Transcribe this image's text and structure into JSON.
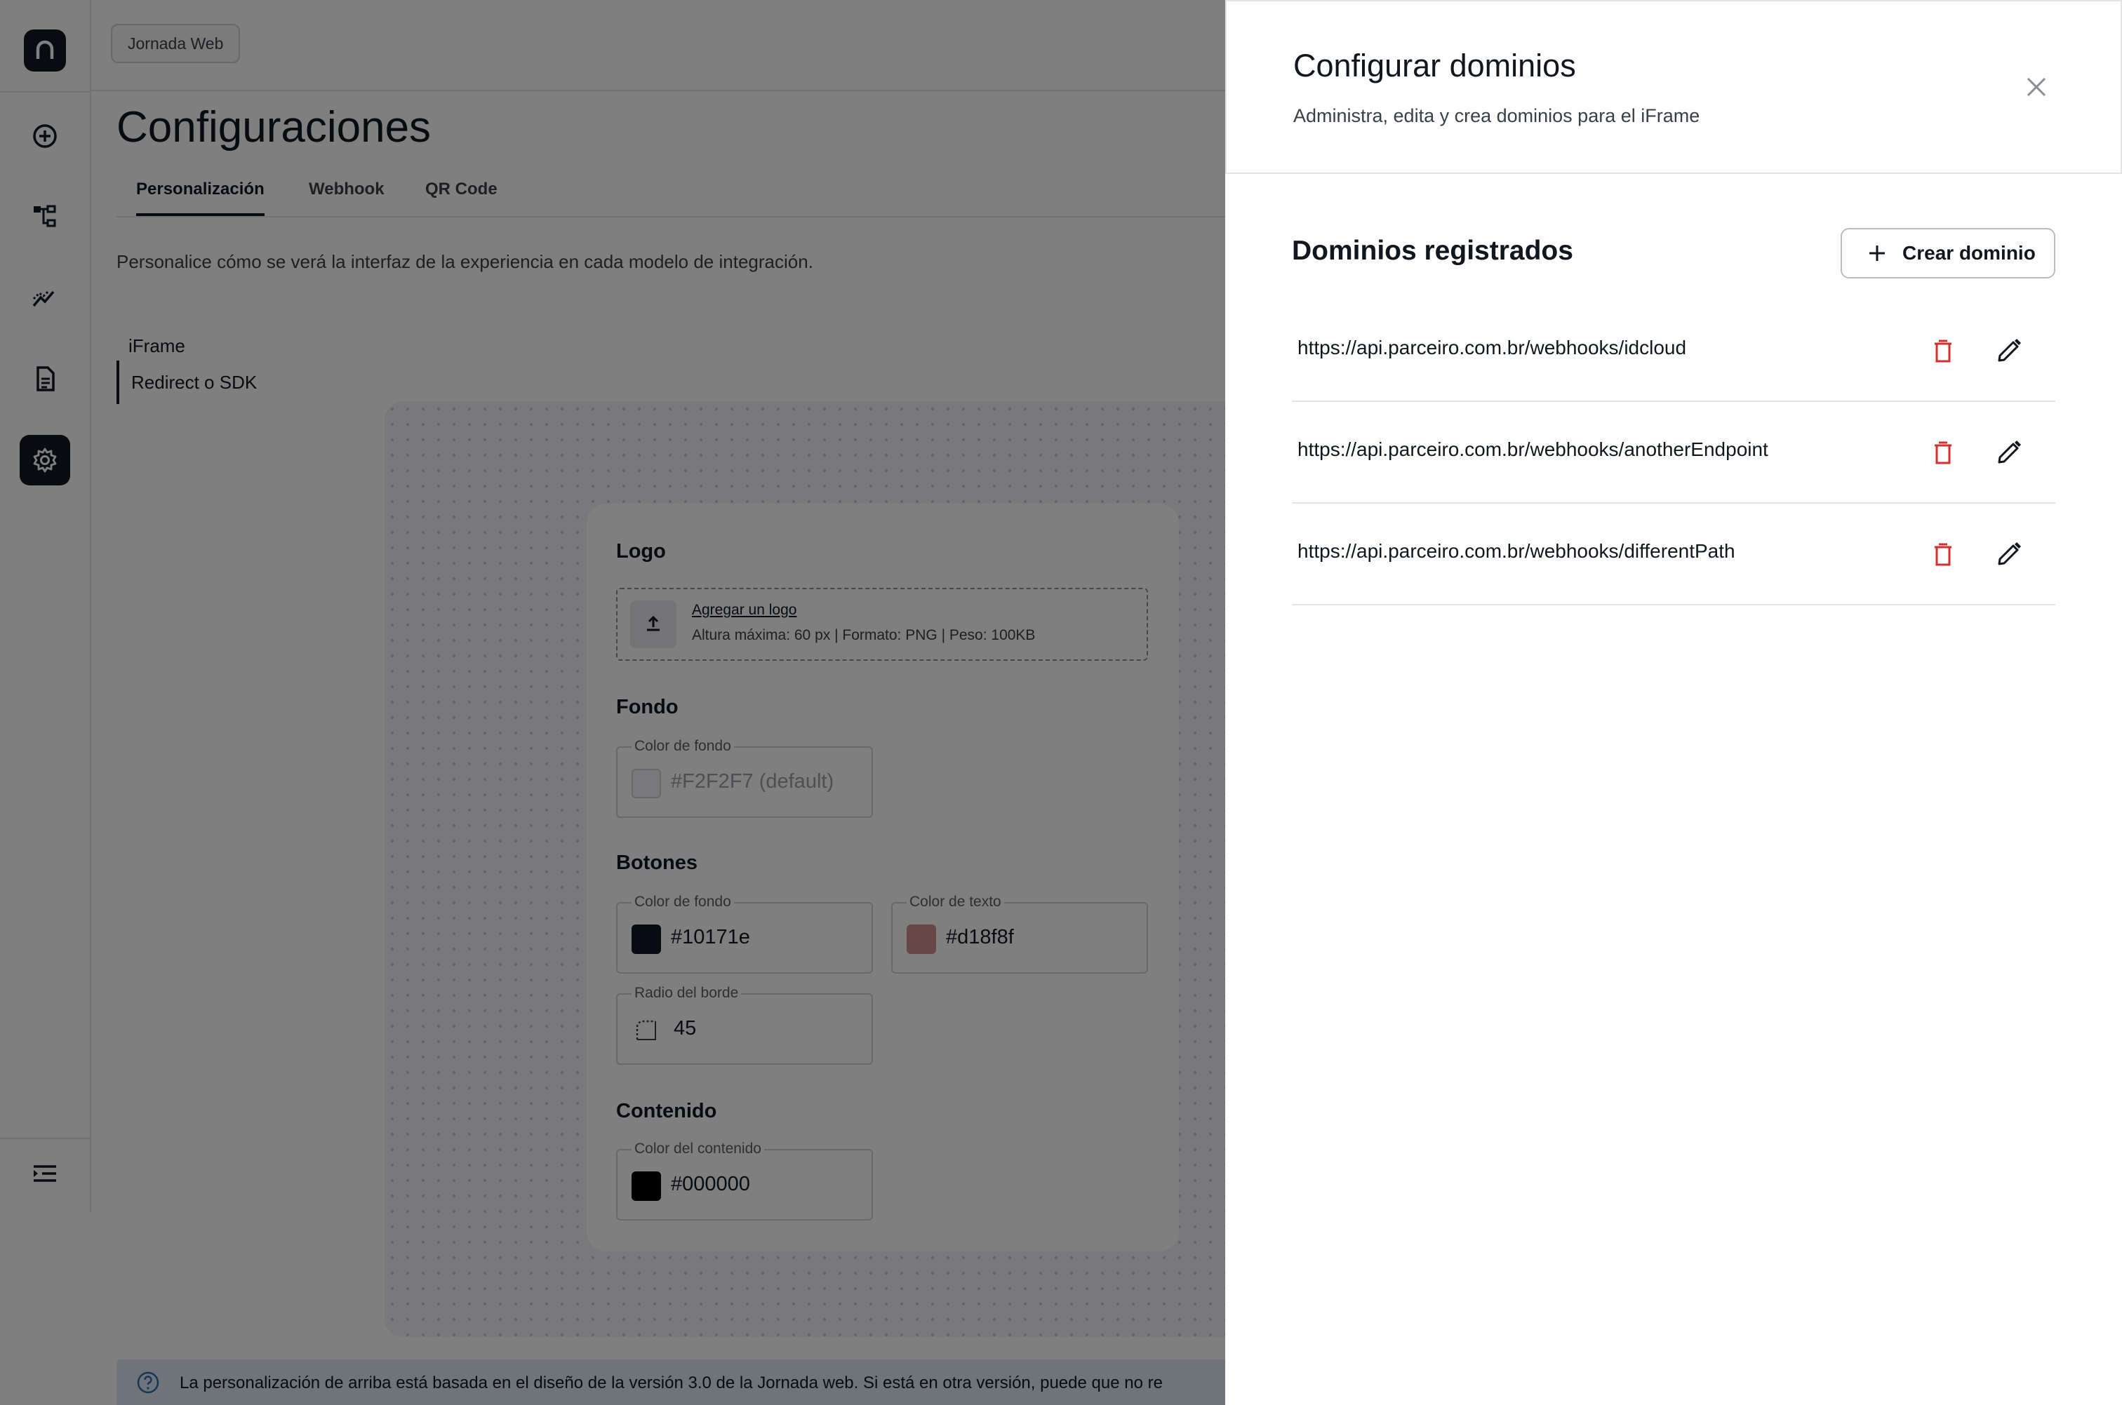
{
  "colors": {
    "accent": "#10171e",
    "danger": "#d32f2f",
    "info_bg": "#dce9f5"
  },
  "breadcrumb": {
    "label": "Jornada Web"
  },
  "sidebar": {
    "items": [
      {
        "icon": "add-circle-icon"
      },
      {
        "icon": "flow-icon"
      },
      {
        "icon": "analytics-icon"
      },
      {
        "icon": "document-icon"
      },
      {
        "icon": "gear-icon",
        "active": true
      }
    ],
    "bottom_icon": "menu-collapse-icon"
  },
  "page": {
    "title": "Configuraciones",
    "tabs": [
      {
        "label": "Personalización",
        "active": true
      },
      {
        "label": "Webhook"
      },
      {
        "label": "QR Code"
      }
    ],
    "description": "Personalice cómo se verá la interfaz de la experiencia en cada modelo de integración.",
    "subnav": [
      {
        "label": "iFrame"
      },
      {
        "label": "Redirect o SDK",
        "active": true
      }
    ]
  },
  "preview": {
    "logo": {
      "title": "Logo",
      "link": "Agregar un logo",
      "hint": "Altura máxima: 60 px | Formato: PNG | Peso: 100KB"
    },
    "fondo": {
      "title": "Fondo",
      "field_label": "Color de fondo",
      "value": "#F2F2F7 (default)",
      "swatch": "#f2f2f7"
    },
    "botones": {
      "title": "Botones",
      "bg_label": "Color de fondo",
      "bg_value": "#10171e",
      "text_label": "Color de texto",
      "text_value": "#d18f8f",
      "radius_label": "Radio del borde",
      "radius_value": "45"
    },
    "contenido": {
      "title": "Contenido",
      "field_label": "Color del contenido",
      "value": "#000000"
    }
  },
  "info_text": "La personalización de arriba está basada en el diseño de la versión 3.0 de la Jornada web. Si está en otra versión, puede que no re",
  "drawer": {
    "title": "Configurar dominios",
    "subtitle": "Administra, edita y crea dominios para el iFrame",
    "list_title": "Dominios registrados",
    "create_label": "Crear dominio",
    "domains": [
      "https://api.parceiro.com.br/webhooks/idcloud",
      "https://api.parceiro.com.br/webhooks/anotherEndpoint",
      "https://api.parceiro.com.br/webhooks/differentPath"
    ]
  }
}
